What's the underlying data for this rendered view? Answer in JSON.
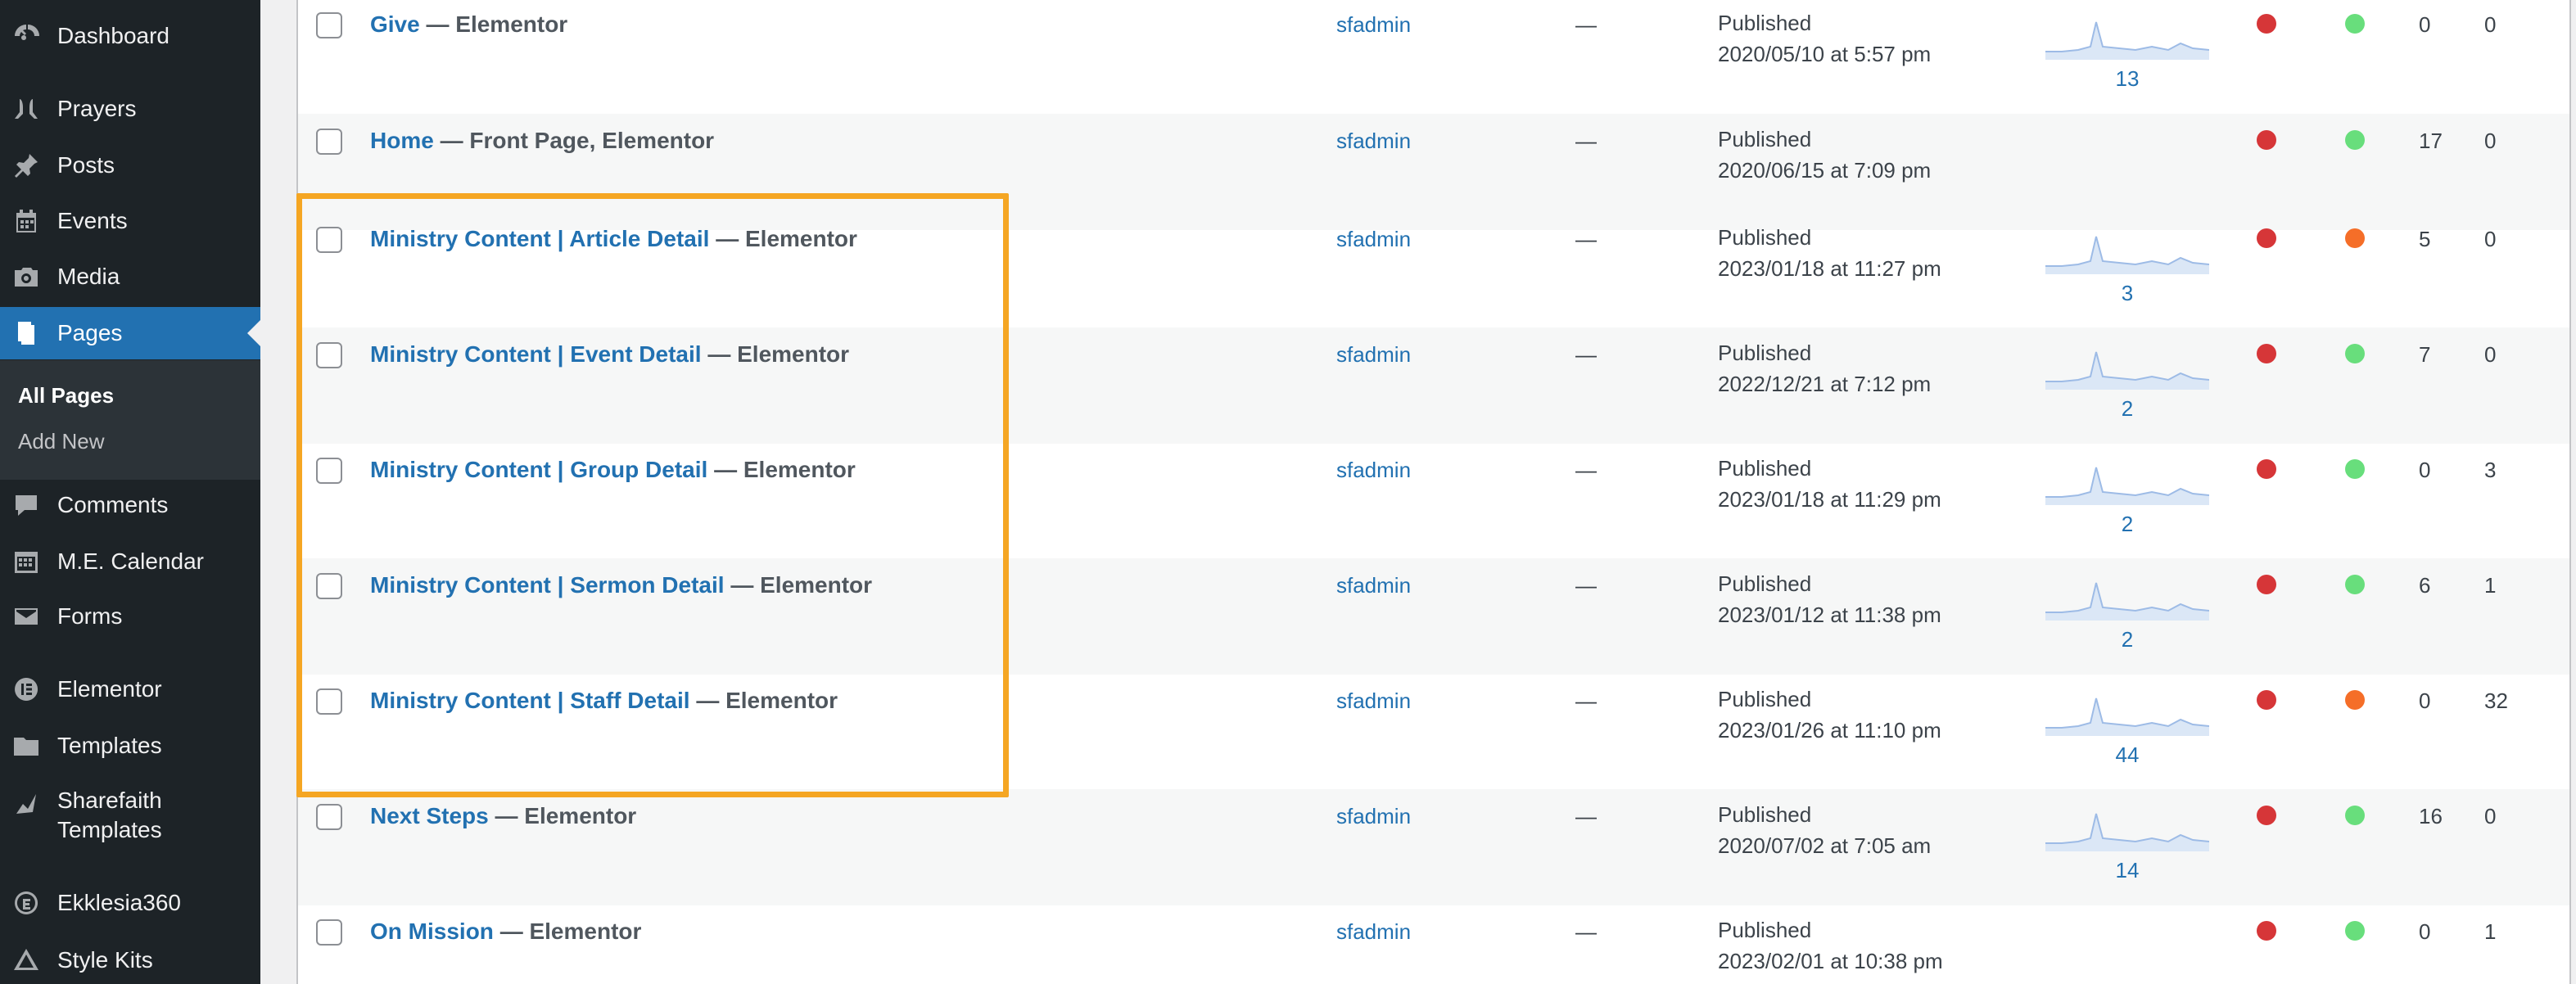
{
  "sidebar": {
    "items": [
      {
        "label": "Dashboard",
        "icon": "dashboard-icon"
      },
      {
        "label": "Prayers",
        "icon": "prayers-icon"
      },
      {
        "label": "Posts",
        "icon": "pin-icon"
      },
      {
        "label": "Events",
        "icon": "calendar-icon"
      },
      {
        "label": "Media",
        "icon": "media-icon"
      },
      {
        "label": "Pages",
        "icon": "pages-icon"
      },
      {
        "label": "Comments",
        "icon": "comment-icon"
      },
      {
        "label": "M.E. Calendar",
        "icon": "calendar-grid-icon"
      },
      {
        "label": "Forms",
        "icon": "envelope-icon"
      },
      {
        "label": "Elementor",
        "icon": "elementor-icon"
      },
      {
        "label": "Templates",
        "icon": "folder-icon"
      },
      {
        "label": "Sharefaith Templates",
        "icon": "sharefaith-icon"
      },
      {
        "label": "Ekklesia360",
        "icon": "ekklesia-icon"
      },
      {
        "label": "Style Kits",
        "icon": "triangle-icon"
      }
    ],
    "submenu": [
      {
        "label": "All Pages",
        "current": true
      },
      {
        "label": "Add New",
        "current": false
      }
    ]
  },
  "rows": [
    {
      "title": "Give",
      "state": "— Elementor",
      "author": "sfadmin",
      "dash": "—",
      "status": "Published",
      "date": "2020/05/10 at 5:57 pm",
      "views": "13",
      "seo": "#d63638",
      "readability": "#68de7c",
      "incoming": "0",
      "outgoing": "0"
    },
    {
      "title": "Home",
      "state": "— Front Page, Elementor",
      "author": "sfadmin",
      "dash": "—",
      "status": "Published",
      "date": "2020/06/15 at 7:09 pm",
      "views": "",
      "seo": "#d63638",
      "readability": "#68de7c",
      "incoming": "17",
      "outgoing": "0"
    },
    {
      "title": "Ministry Content | Article Detail",
      "state": "— Elementor",
      "author": "sfadmin",
      "dash": "—",
      "status": "Published",
      "date": "2023/01/18 at 11:27 pm",
      "views": "3",
      "seo": "#d63638",
      "readability": "#f56e28",
      "incoming": "5",
      "outgoing": "0"
    },
    {
      "title": "Ministry Content | Event Detail",
      "state": "— Elementor",
      "author": "sfadmin",
      "dash": "—",
      "status": "Published",
      "date": "2022/12/21 at 7:12 pm",
      "views": "2",
      "seo": "#d63638",
      "readability": "#68de7c",
      "incoming": "7",
      "outgoing": "0"
    },
    {
      "title": "Ministry Content | Group Detail",
      "state": "— Elementor",
      "author": "sfadmin",
      "dash": "—",
      "status": "Published",
      "date": "2023/01/18 at 11:29 pm",
      "views": "2",
      "seo": "#d63638",
      "readability": "#68de7c",
      "incoming": "0",
      "outgoing": "3"
    },
    {
      "title": "Ministry Content | Sermon Detail",
      "state": "— Elementor",
      "author": "sfadmin",
      "dash": "—",
      "status": "Published",
      "date": "2023/01/12 at 11:38 pm",
      "views": "2",
      "seo": "#d63638",
      "readability": "#68de7c",
      "incoming": "6",
      "outgoing": "1"
    },
    {
      "title": "Ministry Content | Staff Detail",
      "state": "— Elementor",
      "author": "sfadmin",
      "dash": "—",
      "status": "Published",
      "date": "2023/01/26 at 11:10 pm",
      "views": "44",
      "seo": "#d63638",
      "readability": "#f56e28",
      "incoming": "0",
      "outgoing": "32"
    },
    {
      "title": "Next Steps",
      "state": "— Elementor",
      "author": "sfadmin",
      "dash": "—",
      "status": "Published",
      "date": "2020/07/02 at 7:05 am",
      "views": "14",
      "seo": "#d63638",
      "readability": "#68de7c",
      "incoming": "16",
      "outgoing": "0"
    },
    {
      "title": "On Mission",
      "state": "— Elementor",
      "author": "sfadmin",
      "dash": "—",
      "status": "Published",
      "date": "2023/02/01 at 10:38 pm",
      "views": "",
      "seo": "#d63638",
      "readability": "#68de7c",
      "incoming": "0",
      "outgoing": "1"
    }
  ],
  "colors": {
    "highlight": "#f5a623",
    "link": "#2271b1",
    "sidebar": "#1d2327",
    "active": "#2271b1"
  }
}
